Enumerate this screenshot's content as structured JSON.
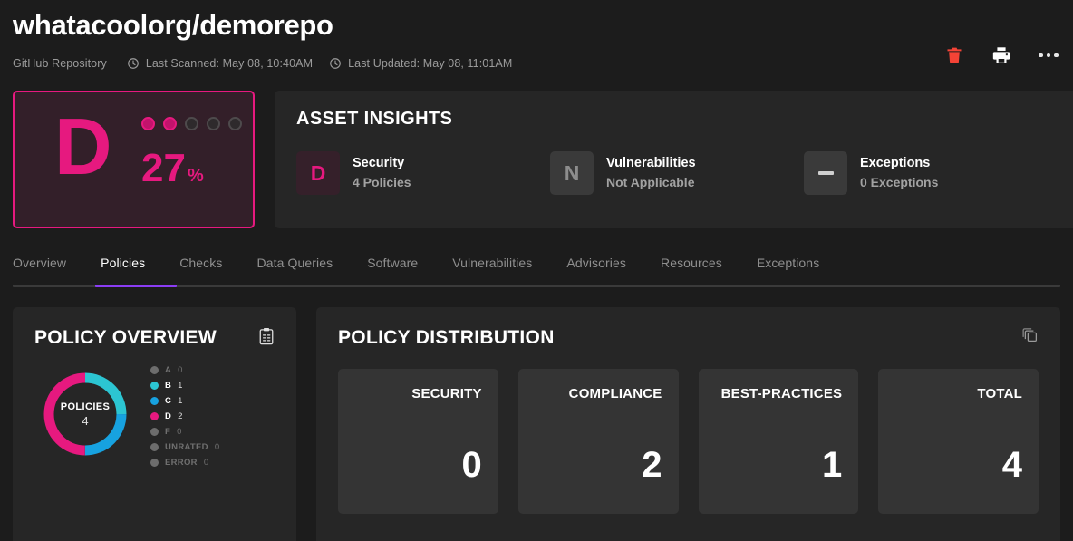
{
  "header": {
    "title": "whatacoolorg/demorepo",
    "subtitle": "GitHub Repository",
    "last_scanned": "Last Scanned: May 08, 10:40AM",
    "last_updated": "Last Updated: May 08, 11:01AM",
    "actions": [
      {
        "name": "delete-button",
        "icon": "trash-icon",
        "color": "#f44336"
      },
      {
        "name": "print-button",
        "icon": "printer-icon",
        "color": "#ffffff"
      },
      {
        "name": "more-options-button",
        "icon": "ellipsis-icon",
        "color": "#e8e8e8"
      }
    ]
  },
  "grade_card": {
    "letter": "D",
    "percent": "27",
    "percent_symbol": "%",
    "dots_total": 5,
    "dots_filled": 2,
    "accent_color": "#e6197f",
    "background_color": "#331f29"
  },
  "asset_insights": {
    "title": "ASSET INSIGHTS",
    "items": [
      {
        "badge": "D",
        "badge_style": "grade-d",
        "label": "Security",
        "value": "4 Policies"
      },
      {
        "badge": "N",
        "badge_style": "na",
        "label": "Vulnerabilities",
        "value": "Not Applicable"
      },
      {
        "badge": "—",
        "badge_style": "none",
        "label": "Exceptions",
        "value": "0 Exceptions"
      }
    ]
  },
  "tabs": {
    "active_index": 1,
    "active_color": "#8b3df5",
    "items": [
      {
        "label": "Overview"
      },
      {
        "label": "Policies"
      },
      {
        "label": "Checks"
      },
      {
        "label": "Data Queries"
      },
      {
        "label": "Software"
      },
      {
        "label": "Vulnerabilities"
      },
      {
        "label": "Advisories"
      },
      {
        "label": "Resources"
      },
      {
        "label": "Exceptions"
      }
    ]
  },
  "policy_overview": {
    "title": "POLICY OVERVIEW",
    "icon": "clipboard-list-icon",
    "donut_center_label": "POLICIES",
    "donut_center_value": "4",
    "legend": [
      {
        "label": "A",
        "count": "0",
        "color": "#6d6d6d",
        "active": false
      },
      {
        "label": "B",
        "count": "1",
        "color": "#2cc5d2",
        "active": true
      },
      {
        "label": "C",
        "count": "1",
        "color": "#17a2e0",
        "active": true
      },
      {
        "label": "D",
        "count": "2",
        "color": "#e6197f",
        "active": true
      },
      {
        "label": "F",
        "count": "0",
        "color": "#6d6d6d",
        "active": false
      },
      {
        "label": "UNRATED",
        "count": "0",
        "color": "#6d6d6d",
        "active": false
      },
      {
        "label": "ERROR",
        "count": "0",
        "color": "#6d6d6d",
        "active": false
      }
    ]
  },
  "policy_distribution": {
    "title": "POLICY DISTRIBUTION",
    "icon": "copy-layers-icon",
    "tiles": [
      {
        "label": "SECURITY",
        "value": "0"
      },
      {
        "label": "COMPLIANCE",
        "value": "2"
      },
      {
        "label": "BEST-PRACTICES",
        "value": "1"
      },
      {
        "label": "TOTAL",
        "value": "4"
      }
    ]
  },
  "chart_data": {
    "type": "pie",
    "title": "POLICY OVERVIEW",
    "labels": [
      "A",
      "B",
      "C",
      "D",
      "F",
      "UNRATED",
      "ERROR"
    ],
    "values": [
      0,
      1,
      1,
      2,
      0,
      0,
      0
    ],
    "colors": [
      "#6d6d6d",
      "#2cc5d2",
      "#17a2e0",
      "#e6197f",
      "#6d6d6d",
      "#6d6d6d",
      "#6d6d6d"
    ],
    "total": 4,
    "center_label": "POLICIES",
    "center_value": "4",
    "legend_position": "right",
    "donut": true
  }
}
